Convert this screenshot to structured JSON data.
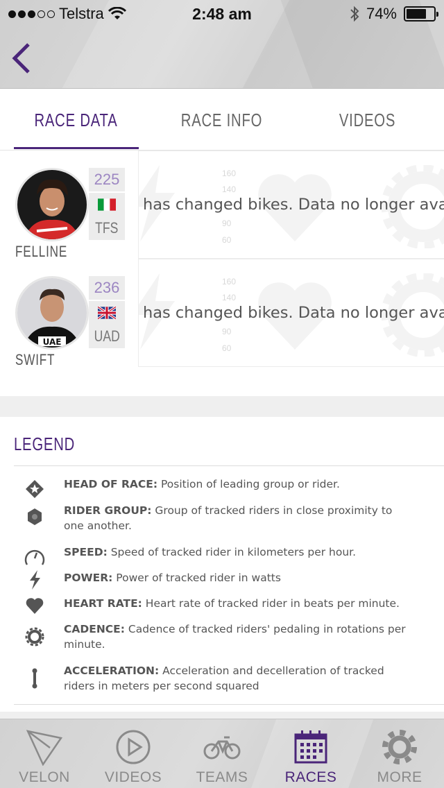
{
  "status_bar": {
    "carrier": "Telstra",
    "time": "2:48 am",
    "battery": "74%",
    "signal_bars_filled": 3,
    "signal_bars_total": 5,
    "battery_level": 0.74
  },
  "header": {
    "back_icon": "chevron-left-icon"
  },
  "tabs": [
    {
      "label": "RACE DATA",
      "active": true
    },
    {
      "label": "RACE INFO",
      "active": false
    },
    {
      "label": "VIDEOS",
      "active": false
    }
  ],
  "riders": [
    {
      "name": "FELLINE",
      "number": "225",
      "flag": "Italy",
      "team": "TFS",
      "message": "has changed bikes. Data no longer available",
      "ticks": [
        "160",
        "140",
        "90",
        "60"
      ]
    },
    {
      "name": "SWIFT",
      "number": "236",
      "flag": "United Kingdom",
      "team": "UAD",
      "message": "has changed bikes. Data no longer available",
      "ticks": [
        "160",
        "140",
        "90",
        "60"
      ]
    }
  ],
  "legend": {
    "title": "LEGEND",
    "items": [
      {
        "icon": "head-of-race-icon",
        "term": "HEAD OF RACE:",
        "desc": " Position of leading group or rider."
      },
      {
        "icon": "rider-group-icon",
        "term": "RIDER GROUP:",
        "desc": " Group of tracked riders in close proximity to one another."
      },
      {
        "icon": "speed-icon",
        "term": "SPEED:",
        "desc": " Speed of tracked rider in kilometers per hour."
      },
      {
        "icon": "power-icon",
        "term": "POWER:",
        "desc": " Power of tracked rider in watts"
      },
      {
        "icon": "heart-rate-icon",
        "term": "HEART RATE:",
        "desc": " Heart rate of tracked rider in beats per minute."
      },
      {
        "icon": "cadence-icon",
        "term": "CADENCE:",
        "desc": " Cadence of tracked riders' pedaling in rotations per minute."
      },
      {
        "icon": "acceleration-icon",
        "term": "ACCELERATION:",
        "desc": " Acceleration and decelleration of tracked riders in meters per second squared"
      }
    ]
  },
  "tab_bar": [
    {
      "label": "VELON",
      "icon": "velon-logo-icon",
      "active": false
    },
    {
      "label": "VIDEOS",
      "icon": "play-icon",
      "active": false
    },
    {
      "label": "TEAMS",
      "icon": "bicycle-icon",
      "active": false
    },
    {
      "label": "RACES",
      "icon": "calendar-icon",
      "active": true
    },
    {
      "label": "MORE",
      "icon": "gear-icon",
      "active": false
    }
  ],
  "colors": {
    "accent": "#4a2579",
    "number": "#9c86c2"
  }
}
